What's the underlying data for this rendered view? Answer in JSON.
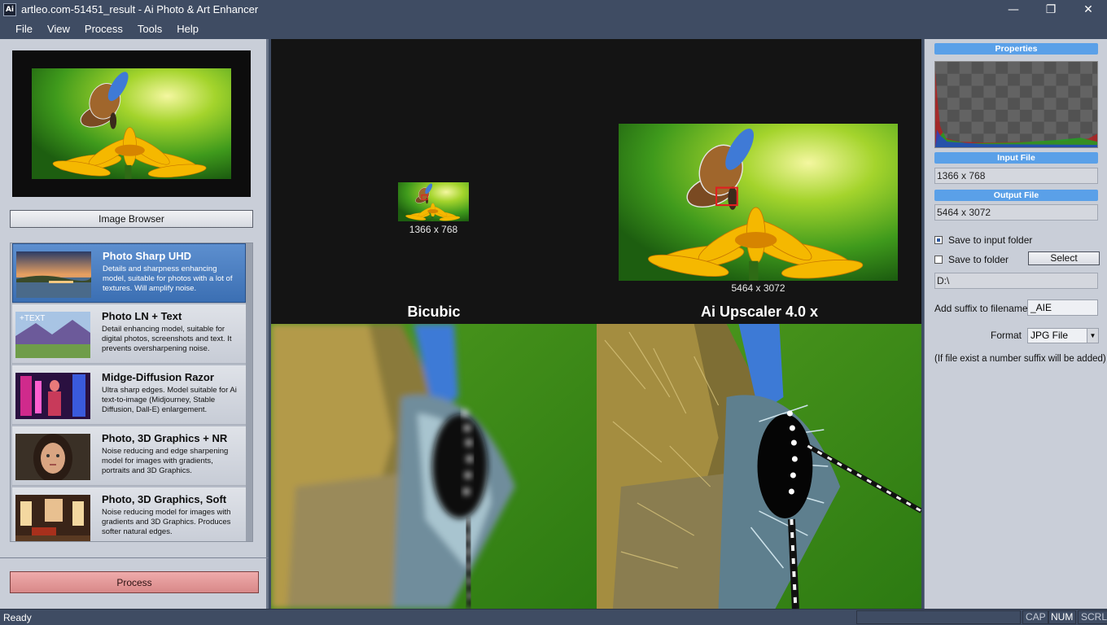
{
  "window": {
    "title": "artleo.com-51451_result - Ai Photo & Art Enhancer",
    "app_icon_text": "Ai",
    "controls": {
      "minimize": "—",
      "maximize": "❐",
      "close": "✕"
    }
  },
  "menu": [
    "File",
    "View",
    "Process",
    "Tools",
    "Help"
  ],
  "left": {
    "browser_button": "Image Browser",
    "process_button": "Process",
    "models": [
      {
        "title": "Photo Sharp UHD",
        "desc": "Details and sharpness enhancing model, suitable for photos with a lot of textures. Will amplify noise.",
        "selected": true
      },
      {
        "title": "Photo LN + Text",
        "desc": "Detail enhancing model, suitable for digital photos, screenshots and text. It prevents oversharpening noise.",
        "thumb_text": "+TEXT"
      },
      {
        "title": "Midge-Diffusion Razor",
        "desc": "Ultra sharp edges. Model suitable for Ai text-to-image (Midjourney, Stable Diffusion, Dall-E) enlargement."
      },
      {
        "title": "Photo, 3D Graphics + NR",
        "desc": "Noise reducing and edge sharpening model for images with gradients, portraits and 3D Graphics."
      },
      {
        "title": "Photo, 3D Graphics, Soft",
        "desc": "Noise reducing model for images with gradients and 3D Graphics. Produces softer natural edges."
      }
    ]
  },
  "center": {
    "input_size": "1366 x 768",
    "output_size": "5464 x 3072",
    "label_left": "Bicubic",
    "label_right": "Ai Upscaler 4.0 x"
  },
  "right": {
    "properties_title": "Properties",
    "input_title": "Input File",
    "input_value": "1366 x 768",
    "output_title": "Output File",
    "output_value": "5464 x 3072",
    "save_input_folder": "Save to input folder",
    "save_to_folder": "Save to folder",
    "select_button": "Select",
    "folder_path": "D:\\",
    "suffix_label": "Add suffix to filename",
    "suffix_value": "_AIE",
    "format_label": "Format",
    "format_value": "JPG File",
    "note": "(If file exist a number suffix will be added)"
  },
  "status": {
    "text": "Ready",
    "cap": "CAP",
    "num": "NUM",
    "scrl": "SCRL"
  }
}
